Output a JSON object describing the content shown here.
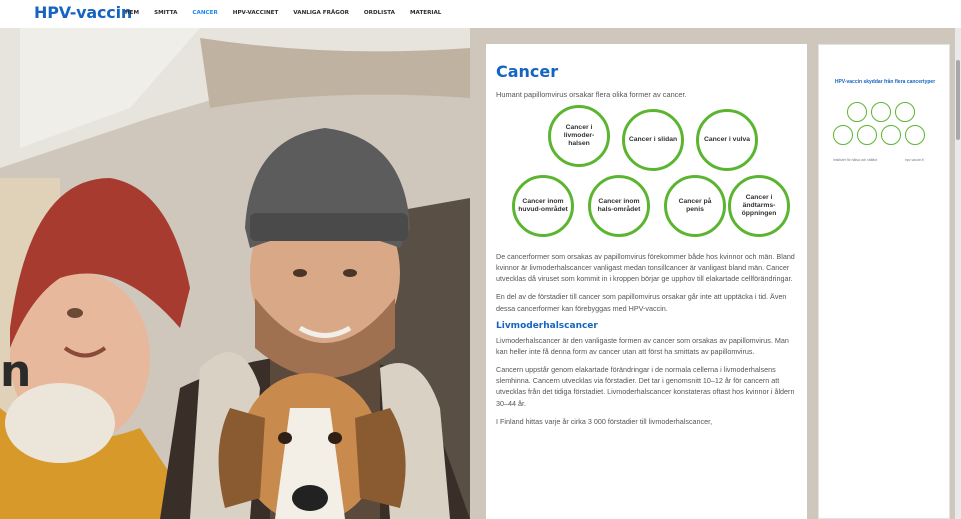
{
  "site": {
    "logo": "HPV-vaccin",
    "nav": [
      "HEM",
      "SMITTA",
      "CANCER",
      "HPV-VACCINET",
      "VANLIGA FRÅGOR",
      "ORDLISTA",
      "MATERIAL"
    ],
    "active_nav": "CANCER"
  },
  "hero": {
    "stray_letter": "n"
  },
  "content": {
    "title": "Cancer",
    "intro": "Humant papillomvirus orsakar flera olika former av cancer.",
    "circles": [
      "Cancer i livmoder-halsen",
      "Cancer i slidan",
      "Cancer i vulva",
      "Cancer inom huvud-området",
      "Cancer inom hals-området",
      "Cancer på penis",
      "Cancer i ändtarms-öppningen"
    ],
    "paragraphs": [
      "De cancerformer som orsakas av papillomvirus förekommer både hos kvinnor och män. Bland kvinnor är livmoderhalscancer vanligast medan tonsillcancer är vanligast bland män. Cancer utvecklas då viruset som kommit in i kroppen börjar ge upphov till elakartade cellförändringar.",
      "En del av de förstadier till cancer som papillomvirus orsakar går inte att upptäcka i tid. Även dessa cancerformer kan förebyggas med HPV-vaccin."
    ],
    "subheading": "Livmoderhalscancer",
    "paragraphs2": [
      "Livmoderhalscancer är den vanligaste formen av cancer som orsakas av papillomvirus. Man kan heller inte få denna form av cancer utan att först ha smittats av papillomvirus.",
      "Cancern uppstår genom elakartade förändringar i de normala cellerna i livmoderhalsens slemhinna. Cancern utvecklas via förstadier. Det tar i genomsnitt 10–12 år för cancern att utvecklas från det tidiga förstadiet. Livmoderhalscancer konstateras oftast hos kvinnor i åldern 30–44 år.",
      "I Finland hittas varje år cirka 3 000 förstadier till livmoderhalscancer,"
    ]
  },
  "thumbnail": {
    "title": "HPV-vaccin skyddar från flera cancertyper",
    "foot_left": "Institutet för hälsa och välfärd",
    "foot_right": "hpv-vaccin.fi"
  },
  "colors": {
    "brand_blue": "#1565c0",
    "accent_green": "#5cb531",
    "nav_active": "#1e88e5"
  },
  "icons": [
    "scrollbar"
  ]
}
